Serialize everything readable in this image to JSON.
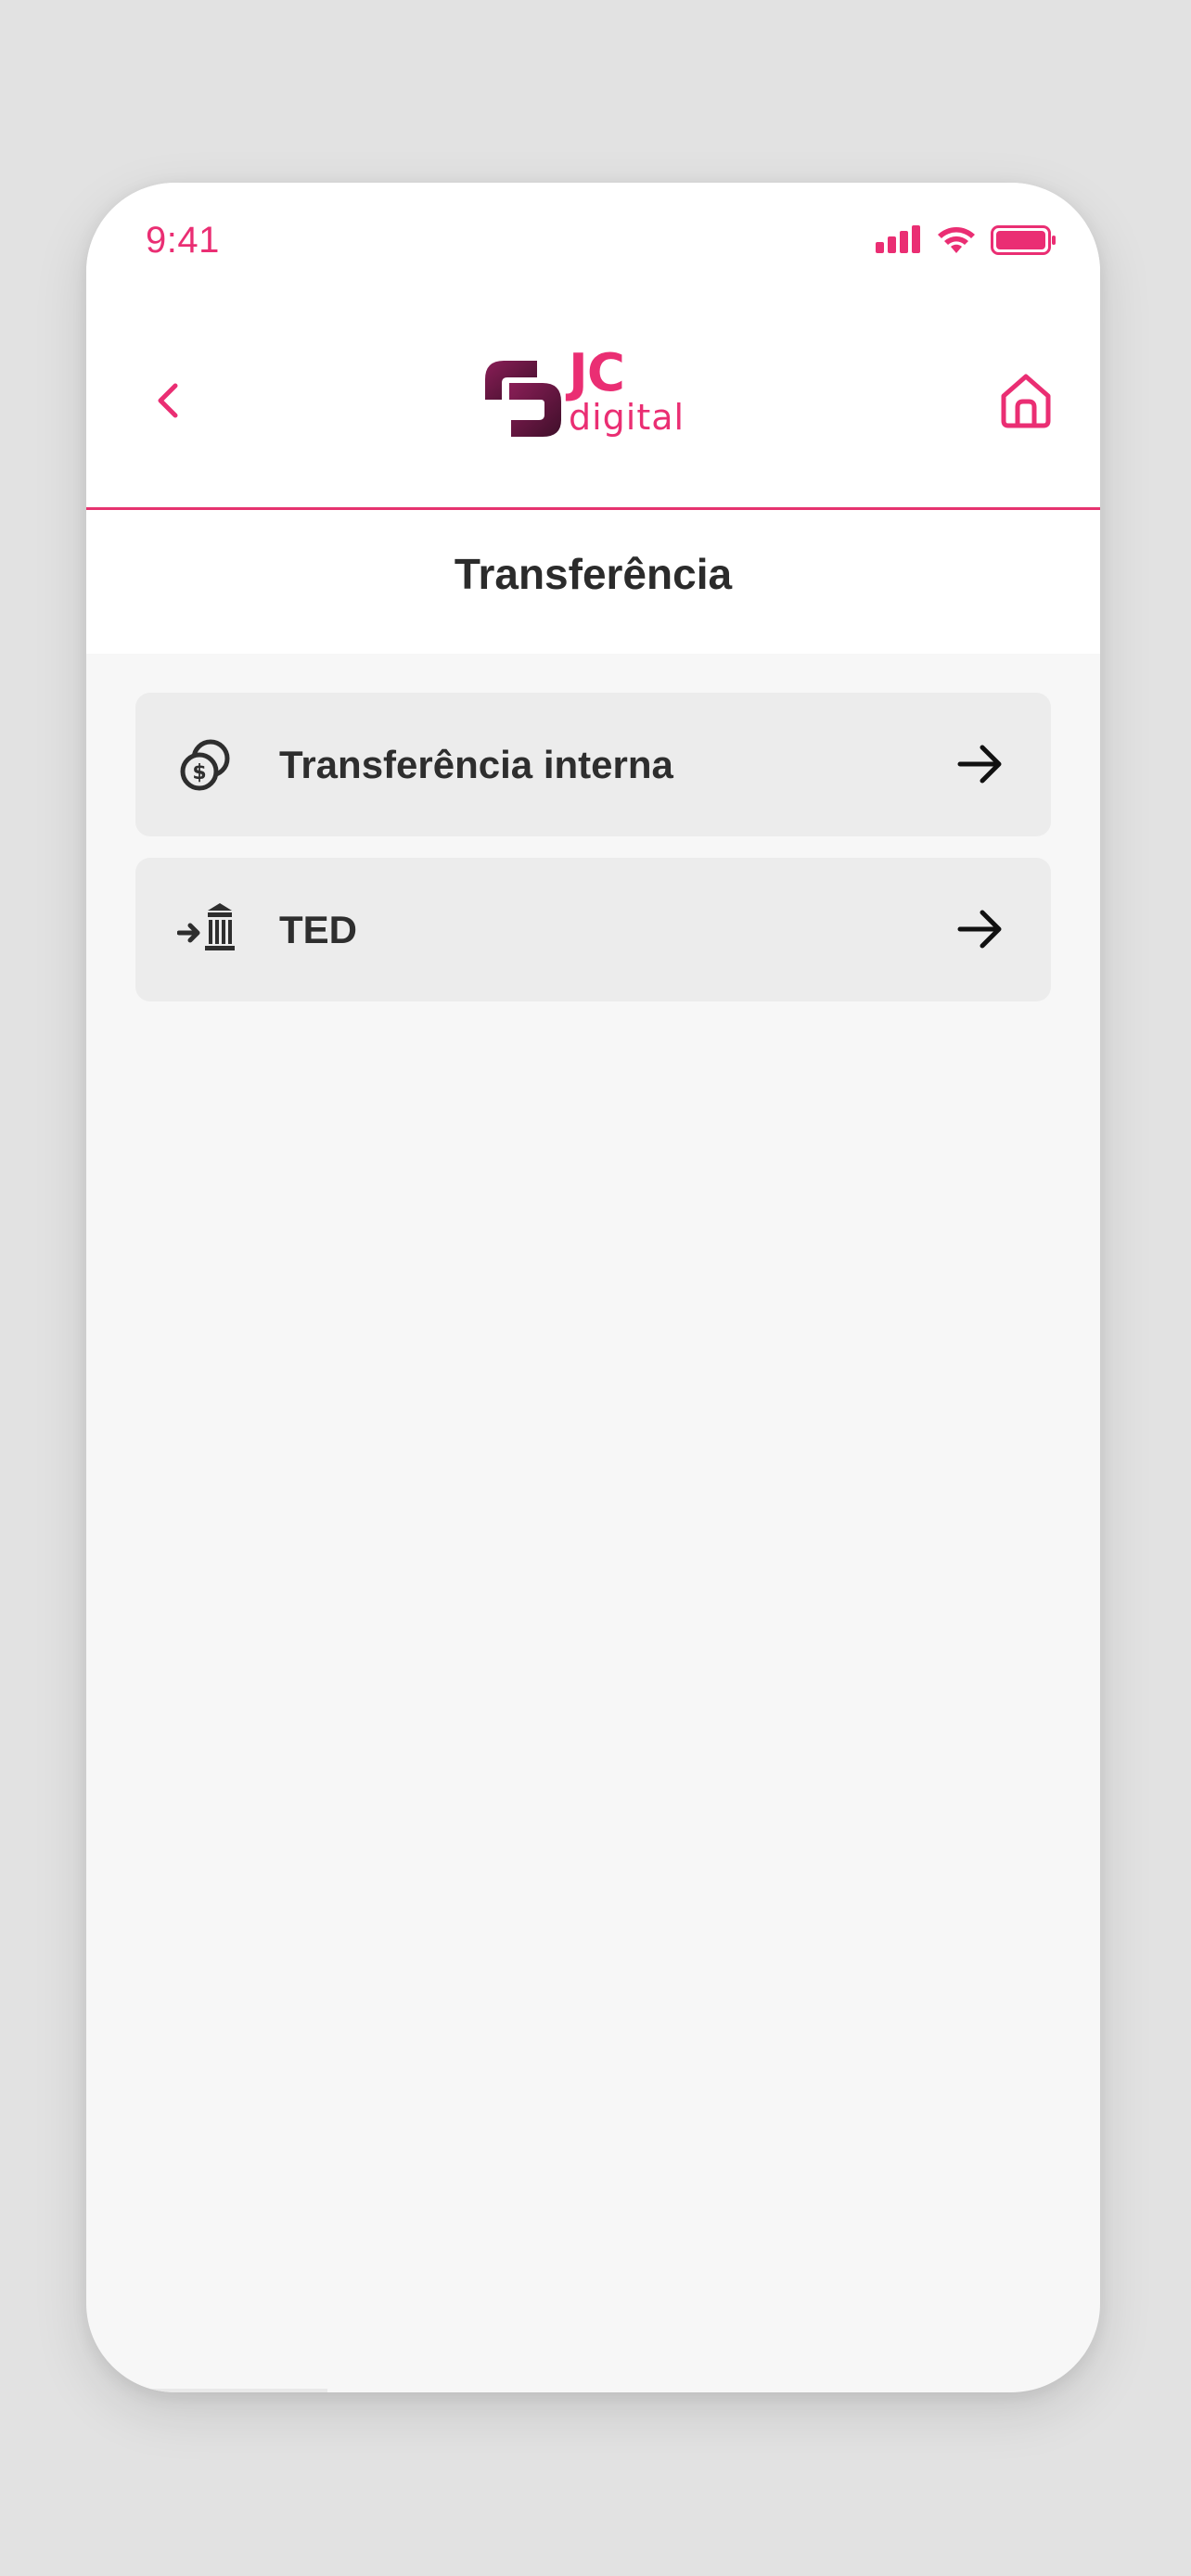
{
  "status_bar": {
    "time": "9:41",
    "icons": [
      "signal-icon",
      "wifi-icon",
      "battery-icon"
    ]
  },
  "header": {
    "back_icon": "chevron-left-icon",
    "home_icon": "home-icon",
    "logo": {
      "brand": "JC",
      "sub": "digital"
    }
  },
  "page": {
    "title": "Transferência"
  },
  "menu": [
    {
      "label": "Transferência interna",
      "icon": "coins-dollar-icon",
      "action_icon": "arrow-right-icon"
    },
    {
      "label": "TED",
      "icon": "bank-transfer-icon",
      "action_icon": "arrow-right-icon"
    }
  ],
  "colors": {
    "accent": "#ea2e73",
    "logo_dark": "#5a1a3c",
    "header_bg": "#ffffff",
    "page_bg": "#f7f7f7",
    "item_bg": "#ececec",
    "text": "#2e2e2e"
  }
}
